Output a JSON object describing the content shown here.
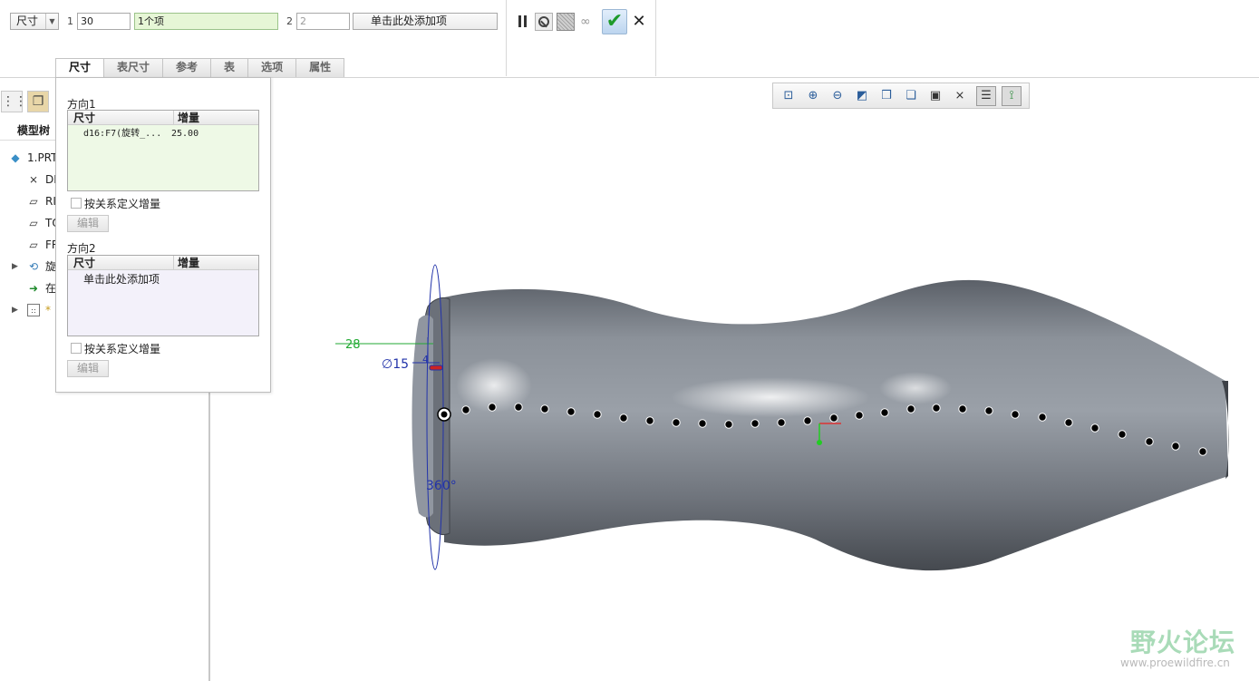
{
  "dashboard": {
    "type_selector": "尺寸",
    "direction1": {
      "label": "1",
      "count": "30",
      "collector": "1个项"
    },
    "direction2": {
      "label": "2",
      "count": "2",
      "collector": "单击此处添加项"
    },
    "tabs": [
      "尺寸",
      "表尺寸",
      "参考",
      "表",
      "选项",
      "属性"
    ],
    "active_tab": "尺寸"
  },
  "model_tree": {
    "title": "模型树",
    "items": [
      {
        "label": "1.PRT",
        "icon": "part-icon"
      },
      {
        "label": "DE",
        "icon": "csys-icon"
      },
      {
        "label": "RI",
        "icon": "datum-plane-icon"
      },
      {
        "label": "TO",
        "icon": "datum-plane-icon"
      },
      {
        "label": "FR",
        "icon": "datum-plane-icon"
      },
      {
        "label": "旋",
        "icon": "revolve-icon",
        "expandable": true
      },
      {
        "label": "在",
        "icon": "insert-here-icon"
      },
      {
        "label": "*",
        "icon": "pattern-icon",
        "expandable": true
      }
    ]
  },
  "dimension_panel": {
    "direction1_title": "方向1",
    "direction2_title": "方向2",
    "col_dimension": "尺寸",
    "col_increment": "增量",
    "dir1_rows": [
      {
        "dimension": "d16:F7(旋转_...",
        "increment": "25.00"
      }
    ],
    "dir2_add_prompt": "单击此处添加项",
    "relation_checkbox": "按关系定义增量",
    "edit_button": "编辑"
  },
  "viewport_annotations": {
    "dim_length": "28",
    "dim_diameter": "∅15",
    "dim_small": "4",
    "dim_angle": "360°"
  },
  "watermark": {
    "text": "野火论坛",
    "url": "www.proewildfire.cn"
  },
  "colors": {
    "body_fill": "#7d838c",
    "accent_green": "#22aa33",
    "dimension_blue": "#2233aa",
    "collector_green": "#e6f6d6"
  }
}
